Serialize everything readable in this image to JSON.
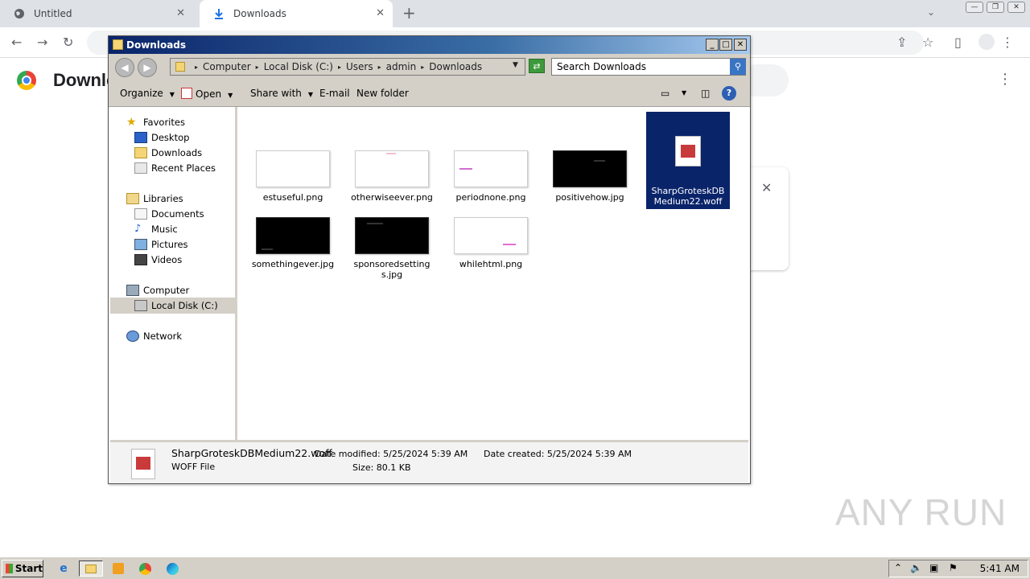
{
  "browser": {
    "tabs": [
      {
        "label": "Untitled",
        "active": false
      },
      {
        "label": "Downloads",
        "active": true
      }
    ],
    "page_title": "Downloads"
  },
  "explorer": {
    "title": "Downloads",
    "breadcrumb": [
      "Computer",
      "Local Disk (C:)",
      "Users",
      "admin",
      "Downloads"
    ],
    "search_placeholder": "Search Downloads",
    "commands": {
      "organize": "Organize",
      "open": "Open",
      "share_with": "Share with",
      "email": "E-mail",
      "new_folder": "New folder"
    },
    "nav": {
      "favorites": "Favorites",
      "desktop": "Desktop",
      "downloads": "Downloads",
      "recent_places": "Recent Places",
      "libraries": "Libraries",
      "documents": "Documents",
      "music": "Music",
      "pictures": "Pictures",
      "videos": "Videos",
      "computer": "Computer",
      "local_disk": "Local Disk (C:)",
      "network": "Network"
    },
    "files": [
      {
        "name": "estuseful.png",
        "thumb": "light"
      },
      {
        "name": "otherwiseever.png",
        "thumb": "light"
      },
      {
        "name": "periodnone.png",
        "thumb": "light"
      },
      {
        "name": "positivehow.jpg",
        "thumb": "dark"
      },
      {
        "name": "SharpGroteskDBMedium22.woff",
        "thumb": "woff",
        "selected": true
      },
      {
        "name": "somethingever.jpg",
        "thumb": "dark"
      },
      {
        "name": "sponsoredsettings.jpg",
        "thumb": "dark"
      },
      {
        "name": "whilehtml.png",
        "thumb": "light"
      }
    ],
    "status": {
      "filename": "SharpGroteskDBMedium22.woff",
      "filetype": "WOFF File",
      "date_modified": "Date modified: 5/25/2024 5:39 AM",
      "date_created": "Date created: 5/25/2024 5:39 AM",
      "size": "Size: 80.1 KB"
    }
  },
  "taskbar": {
    "start": "Start",
    "clock": "5:41 AM"
  },
  "watermark": "ANY RUN"
}
